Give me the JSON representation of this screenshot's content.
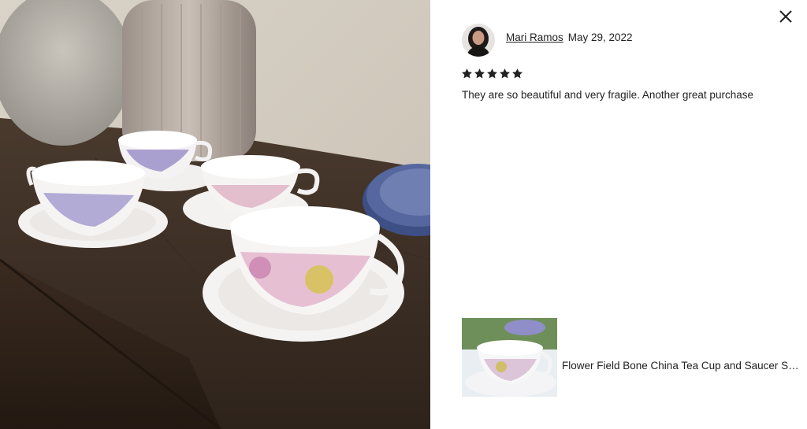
{
  "review": {
    "reviewer_name": "Mari Ramos",
    "date": "May 29, 2022",
    "rating": 5,
    "rating_max": 5,
    "text": "They are so beautiful and very fragile. Another great purchase"
  },
  "product": {
    "title": "Flower Field Bone China Tea Cup and Saucer Set of..."
  },
  "icons": {
    "close": "close-icon",
    "star": "star-icon"
  },
  "colors": {
    "text": "#222222",
    "background": "#ffffff"
  }
}
